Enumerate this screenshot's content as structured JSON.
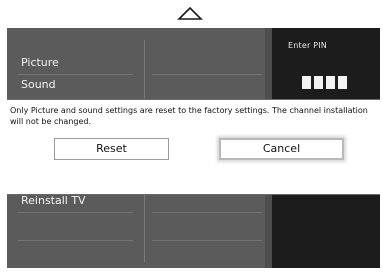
{
  "nav": {
    "up_arrow_icon": "triangle-up-outline"
  },
  "menu": {
    "items": [
      {
        "label": "Picture"
      },
      {
        "label": "Sound"
      },
      {
        "label": "Reinstall TV"
      }
    ]
  },
  "pin": {
    "label": "Enter PIN",
    "digits_count": 4
  },
  "dialog": {
    "message": "Only Picture and sound settings are reset to the factory settings. The channel installation will not  be changed.",
    "reset_label": "Reset",
    "cancel_label": "Cancel",
    "focused_button": "cancel"
  },
  "colors": {
    "menu_background": "#5b5b5b",
    "pin_panel_background": "#1c1c1c",
    "dialog_background": "#ffffff"
  }
}
